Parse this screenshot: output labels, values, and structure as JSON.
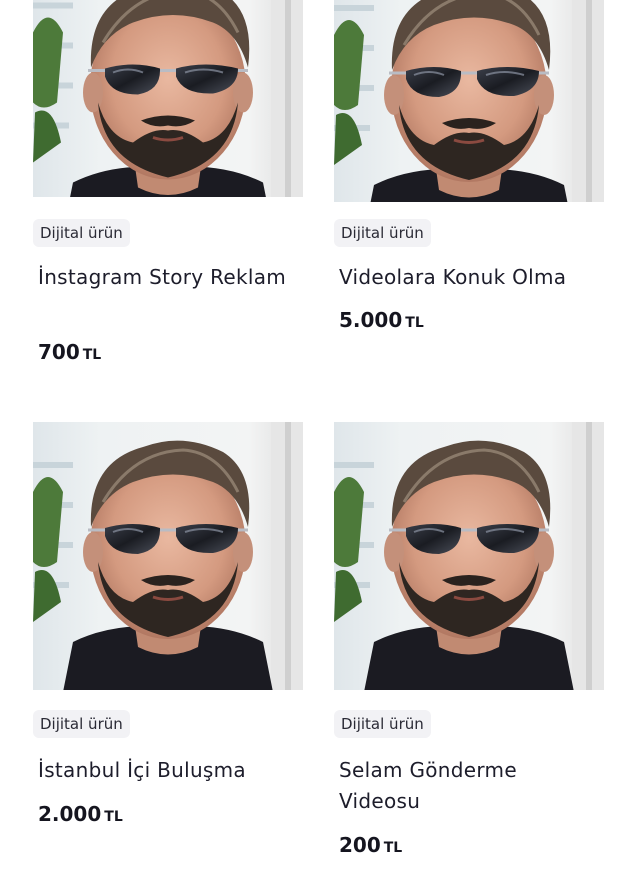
{
  "products": [
    {
      "category": "Dijital ürün",
      "title": "İnstagram Story Reklam",
      "price": "700",
      "currency": "TL"
    },
    {
      "category": "Dijital ürün",
      "title": "Videolara Konuk Olma",
      "price": "5.000",
      "currency": "TL"
    },
    {
      "category": "Dijital ürün",
      "title": "İstanbul İçi Buluşma",
      "price": "2.000",
      "currency": "TL"
    },
    {
      "category": "Dijital ürün",
      "title": "Selam Gönderme Videosu",
      "price": "200",
      "currency": "TL"
    }
  ],
  "colors": {
    "badge_bg": "#f2f2f5",
    "text": "#1d1d2b"
  }
}
